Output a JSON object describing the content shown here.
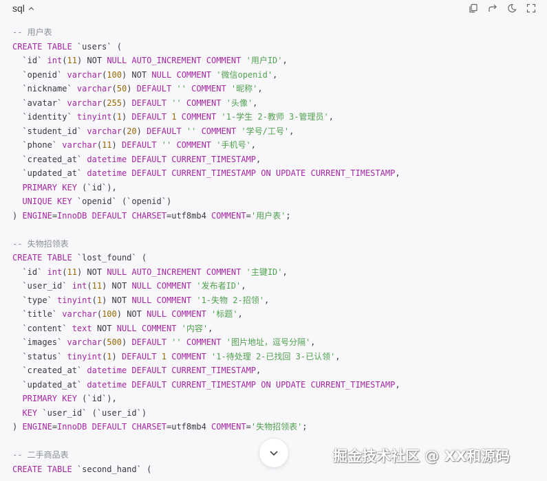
{
  "header": {
    "language": "sql",
    "tools": [
      "copy-icon",
      "share-icon",
      "theme-icon",
      "expand-icon"
    ]
  },
  "code": {
    "lines": [
      [
        {
          "t": "c",
          "v": "-- 用户表"
        }
      ],
      [
        {
          "t": "k",
          "v": "CREATE TABLE "
        },
        {
          "t": "t",
          "v": "`users` ("
        }
      ],
      [
        {
          "t": "t",
          "v": "  `id` "
        },
        {
          "t": "k",
          "v": "int"
        },
        {
          "t": "t",
          "v": "("
        },
        {
          "t": "n",
          "v": "11"
        },
        {
          "t": "t",
          "v": ") NOT "
        },
        {
          "t": "k",
          "v": "NULL AUTO_INCREMENT COMMENT "
        },
        {
          "t": "s",
          "v": "'用户ID'"
        },
        {
          "t": "t",
          "v": ","
        }
      ],
      [
        {
          "t": "t",
          "v": "  `openid` "
        },
        {
          "t": "k",
          "v": "varchar"
        },
        {
          "t": "t",
          "v": "("
        },
        {
          "t": "n",
          "v": "100"
        },
        {
          "t": "t",
          "v": ") NOT "
        },
        {
          "t": "k",
          "v": "NULL COMMENT "
        },
        {
          "t": "s",
          "v": "'微信openid'"
        },
        {
          "t": "t",
          "v": ","
        }
      ],
      [
        {
          "t": "t",
          "v": "  `nickname` "
        },
        {
          "t": "k",
          "v": "varchar"
        },
        {
          "t": "t",
          "v": "("
        },
        {
          "t": "n",
          "v": "50"
        },
        {
          "t": "t",
          "v": ") "
        },
        {
          "t": "k",
          "v": "DEFAULT "
        },
        {
          "t": "s",
          "v": "'' "
        },
        {
          "t": "k",
          "v": "COMMENT "
        },
        {
          "t": "s",
          "v": "'昵称'"
        },
        {
          "t": "t",
          "v": ","
        }
      ],
      [
        {
          "t": "t",
          "v": "  `avatar` "
        },
        {
          "t": "k",
          "v": "varchar"
        },
        {
          "t": "t",
          "v": "("
        },
        {
          "t": "n",
          "v": "255"
        },
        {
          "t": "t",
          "v": ") "
        },
        {
          "t": "k",
          "v": "DEFAULT "
        },
        {
          "t": "s",
          "v": "'' "
        },
        {
          "t": "k",
          "v": "COMMENT "
        },
        {
          "t": "s",
          "v": "'头像'"
        },
        {
          "t": "t",
          "v": ","
        }
      ],
      [
        {
          "t": "t",
          "v": "  `identity` "
        },
        {
          "t": "k",
          "v": "tinyint"
        },
        {
          "t": "t",
          "v": "("
        },
        {
          "t": "n",
          "v": "1"
        },
        {
          "t": "t",
          "v": ") "
        },
        {
          "t": "k",
          "v": "DEFAULT "
        },
        {
          "t": "n",
          "v": "1"
        },
        {
          "t": "k",
          "v": " COMMENT "
        },
        {
          "t": "s",
          "v": "'1-学生 2-教师 3-管理员'"
        },
        {
          "t": "t",
          "v": ","
        }
      ],
      [
        {
          "t": "t",
          "v": "  `student_id` "
        },
        {
          "t": "k",
          "v": "varchar"
        },
        {
          "t": "t",
          "v": "("
        },
        {
          "t": "n",
          "v": "20"
        },
        {
          "t": "t",
          "v": ") "
        },
        {
          "t": "k",
          "v": "DEFAULT "
        },
        {
          "t": "s",
          "v": "'' "
        },
        {
          "t": "k",
          "v": "COMMENT "
        },
        {
          "t": "s",
          "v": "'学号/工号'"
        },
        {
          "t": "t",
          "v": ","
        }
      ],
      [
        {
          "t": "t",
          "v": "  `phone` "
        },
        {
          "t": "k",
          "v": "varchar"
        },
        {
          "t": "t",
          "v": "("
        },
        {
          "t": "n",
          "v": "11"
        },
        {
          "t": "t",
          "v": ") "
        },
        {
          "t": "k",
          "v": "DEFAULT "
        },
        {
          "t": "s",
          "v": "'' "
        },
        {
          "t": "k",
          "v": "COMMENT "
        },
        {
          "t": "s",
          "v": "'手机号'"
        },
        {
          "t": "t",
          "v": ","
        }
      ],
      [
        {
          "t": "t",
          "v": "  `created_at` "
        },
        {
          "t": "k",
          "v": "datetime DEFAULT CURRENT_TIMESTAMP"
        },
        {
          "t": "t",
          "v": ","
        }
      ],
      [
        {
          "t": "t",
          "v": "  `updated_at` "
        },
        {
          "t": "k",
          "v": "datetime DEFAULT CURRENT_TIMESTAMP ON UPDATE CURRENT_TIMESTAMP"
        },
        {
          "t": "t",
          "v": ","
        }
      ],
      [
        {
          "t": "t",
          "v": "  "
        },
        {
          "t": "k",
          "v": "PRIMARY KEY "
        },
        {
          "t": "t",
          "v": "(`id`),"
        }
      ],
      [
        {
          "t": "t",
          "v": "  "
        },
        {
          "t": "k",
          "v": "UNIQUE KEY "
        },
        {
          "t": "t",
          "v": "`openid` (`openid`)"
        }
      ],
      [
        {
          "t": "t",
          "v": ") "
        },
        {
          "t": "k",
          "v": "ENGINE"
        },
        {
          "t": "t",
          "v": "="
        },
        {
          "t": "k",
          "v": "InnoDB DEFAULT CHARSET"
        },
        {
          "t": "t",
          "v": "=utf8mb4 "
        },
        {
          "t": "k",
          "v": "COMMENT"
        },
        {
          "t": "t",
          "v": "="
        },
        {
          "t": "s",
          "v": "'用户表'"
        },
        {
          "t": "t",
          "v": ";"
        }
      ],
      [],
      [
        {
          "t": "c",
          "v": "-- 失物招领表"
        }
      ],
      [
        {
          "t": "k",
          "v": "CREATE TABLE "
        },
        {
          "t": "t",
          "v": "`lost_found` ("
        }
      ],
      [
        {
          "t": "t",
          "v": "  `id` "
        },
        {
          "t": "k",
          "v": "int"
        },
        {
          "t": "t",
          "v": "("
        },
        {
          "t": "n",
          "v": "11"
        },
        {
          "t": "t",
          "v": ") NOT "
        },
        {
          "t": "k",
          "v": "NULL AUTO_INCREMENT COMMENT "
        },
        {
          "t": "s",
          "v": "'主键ID'"
        },
        {
          "t": "t",
          "v": ","
        }
      ],
      [
        {
          "t": "t",
          "v": "  `user_id` "
        },
        {
          "t": "k",
          "v": "int"
        },
        {
          "t": "t",
          "v": "("
        },
        {
          "t": "n",
          "v": "11"
        },
        {
          "t": "t",
          "v": ") NOT "
        },
        {
          "t": "k",
          "v": "NULL COMMENT "
        },
        {
          "t": "s",
          "v": "'发布者ID'"
        },
        {
          "t": "t",
          "v": ","
        }
      ],
      [
        {
          "t": "t",
          "v": "  `type` "
        },
        {
          "t": "k",
          "v": "tinyint"
        },
        {
          "t": "t",
          "v": "("
        },
        {
          "t": "n",
          "v": "1"
        },
        {
          "t": "t",
          "v": ") NOT "
        },
        {
          "t": "k",
          "v": "NULL COMMENT "
        },
        {
          "t": "s",
          "v": "'1-失物 2-招领'"
        },
        {
          "t": "t",
          "v": ","
        }
      ],
      [
        {
          "t": "t",
          "v": "  `title` "
        },
        {
          "t": "k",
          "v": "varchar"
        },
        {
          "t": "t",
          "v": "("
        },
        {
          "t": "n",
          "v": "100"
        },
        {
          "t": "t",
          "v": ") NOT "
        },
        {
          "t": "k",
          "v": "NULL COMMENT "
        },
        {
          "t": "s",
          "v": "'标题'"
        },
        {
          "t": "t",
          "v": ","
        }
      ],
      [
        {
          "t": "t",
          "v": "  `content` "
        },
        {
          "t": "k",
          "v": "text"
        },
        {
          "t": "t",
          "v": " NOT "
        },
        {
          "t": "k",
          "v": "NULL COMMENT "
        },
        {
          "t": "s",
          "v": "'内容'"
        },
        {
          "t": "t",
          "v": ","
        }
      ],
      [
        {
          "t": "t",
          "v": "  `images` "
        },
        {
          "t": "k",
          "v": "varchar"
        },
        {
          "t": "t",
          "v": "("
        },
        {
          "t": "n",
          "v": "500"
        },
        {
          "t": "t",
          "v": ") "
        },
        {
          "t": "k",
          "v": "DEFAULT "
        },
        {
          "t": "s",
          "v": "'' "
        },
        {
          "t": "k",
          "v": "COMMENT "
        },
        {
          "t": "s",
          "v": "'图片地址，逗号分隔'"
        },
        {
          "t": "t",
          "v": ","
        }
      ],
      [
        {
          "t": "t",
          "v": "  `status` "
        },
        {
          "t": "k",
          "v": "tinyint"
        },
        {
          "t": "t",
          "v": "("
        },
        {
          "t": "n",
          "v": "1"
        },
        {
          "t": "t",
          "v": ") "
        },
        {
          "t": "k",
          "v": "DEFAULT "
        },
        {
          "t": "n",
          "v": "1"
        },
        {
          "t": "k",
          "v": " COMMENT "
        },
        {
          "t": "s",
          "v": "'1-待处理 2-已找回 3-已认领'"
        },
        {
          "t": "t",
          "v": ","
        }
      ],
      [
        {
          "t": "t",
          "v": "  `created_at` "
        },
        {
          "t": "k",
          "v": "datetime DEFAULT CURRENT_TIMESTAMP"
        },
        {
          "t": "t",
          "v": ","
        }
      ],
      [
        {
          "t": "t",
          "v": "  `updated_at` "
        },
        {
          "t": "k",
          "v": "datetime DEFAULT CURRENT_TIMESTAMP ON UPDATE CURRENT_TIMESTAMP"
        },
        {
          "t": "t",
          "v": ","
        }
      ],
      [
        {
          "t": "t",
          "v": "  "
        },
        {
          "t": "k",
          "v": "PRIMARY KEY "
        },
        {
          "t": "t",
          "v": "(`id`),"
        }
      ],
      [
        {
          "t": "t",
          "v": "  "
        },
        {
          "t": "k",
          "v": "KEY "
        },
        {
          "t": "t",
          "v": "`user_id` (`user_id`)"
        }
      ],
      [
        {
          "t": "t",
          "v": ") "
        },
        {
          "t": "k",
          "v": "ENGINE"
        },
        {
          "t": "t",
          "v": "="
        },
        {
          "t": "k",
          "v": "InnoDB DEFAULT CHARSET"
        },
        {
          "t": "t",
          "v": "=utf8mb4 "
        },
        {
          "t": "k",
          "v": "COMMENT"
        },
        {
          "t": "t",
          "v": "="
        },
        {
          "t": "s",
          "v": "'失物招领表'"
        },
        {
          "t": "t",
          "v": ";"
        }
      ],
      [],
      [
        {
          "t": "c",
          "v": "-- 二手商品表"
        }
      ],
      [
        {
          "t": "k",
          "v": "CREATE TABLE "
        },
        {
          "t": "t",
          "v": "`second_hand` ("
        }
      ]
    ]
  },
  "scroll_button": {
    "icon": "chevron-down-icon"
  },
  "watermark": "掘金技术社区 @ XX和源码",
  "colors": {
    "background": "#f8f8fa",
    "keyword": "#a626a4",
    "string": "#50a14f",
    "number": "#986801",
    "comment": "#8a8f98",
    "text": "#383a42"
  }
}
